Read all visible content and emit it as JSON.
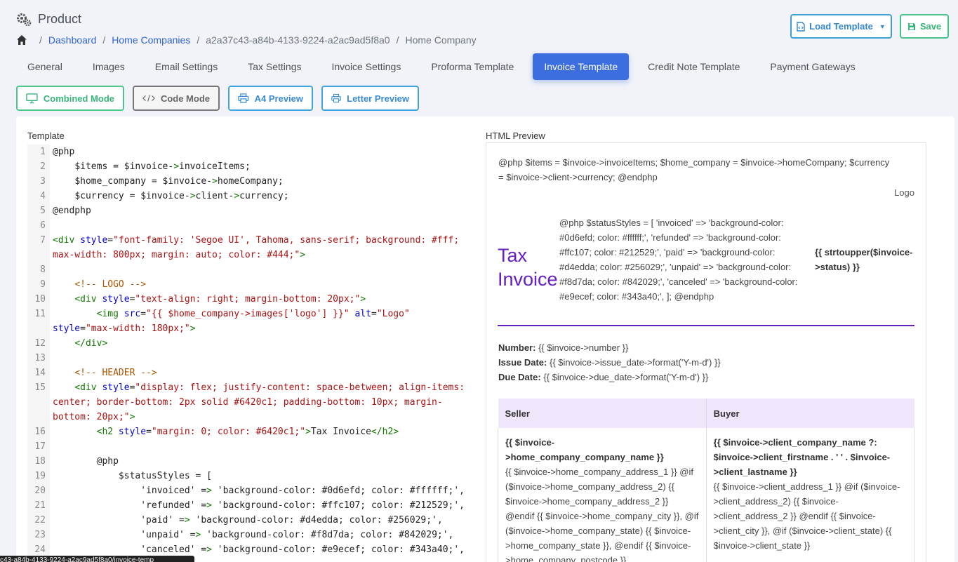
{
  "page": {
    "title": "Product"
  },
  "breadcrumb": {
    "items": [
      "Dashboard",
      "Home Companies",
      "a2a37c43-a84b-4133-9224-a2ac9ad5f8a0",
      "Home Company"
    ]
  },
  "actions": {
    "load_template": "Load Template",
    "save": "Save"
  },
  "tabs": [
    "General",
    "Images",
    "Email Settings",
    "Tax Settings",
    "Invoice Settings",
    "Proforma Template",
    "Invoice Template",
    "Credit Note Template",
    "Payment Gateways"
  ],
  "active_tab": "Invoice Template",
  "modes": {
    "combined": "Combined Mode",
    "code": "Code Mode",
    "a4": "A4 Preview",
    "letter": "Letter Preview"
  },
  "template_label": "Template",
  "preview_label": "HTML Preview",
  "code_lines": [
    "@php",
    "    $items = $invoice->invoiceItems;",
    "    $home_company = $invoice->homeCompany;",
    "    $currency = $invoice->client->currency;",
    "@endphp",
    "",
    "<div style=\"font-family: 'Segoe UI', Tahoma, sans-serif; background: #fff; max-width: 800px; margin: auto; color: #444;\">",
    "",
    "    <!-- LOGO -->",
    "    <div style=\"text-align: right; margin-bottom: 20px;\">",
    "        <img src=\"{{ $home_company->images['logo'] }}\" alt=\"Logo\" style=\"max-width: 180px;\">",
    "    </div>",
    "",
    "    <!-- HEADER -->",
    "    <div style=\"display: flex; justify-content: space-between; align-items: center; border-bottom: 2px solid #6420c1; padding-bottom: 10px; margin-bottom: 20px;\">",
    "        <h2 style=\"margin: 0; color: #6420c1;\">Tax Invoice</h2>",
    "",
    "        @php",
    "            $statusStyles = [",
    "                'invoiced' => 'background-color: #0d6efd; color: #ffffff;',",
    "                'refunded' => 'background-color: #ffc107; color: #212529;',",
    "                'paid' => 'background-color: #d4edda; color: #256029;',",
    "                'unpaid' => 'background-color: #f8d7da; color: #842029;',",
    "                'canceled' => 'background-color: #e9ecef; color: #343a40;',"
  ],
  "preview": {
    "php_block": "@php $items = $invoice->invoiceItems; $home_company = $invoice->homeCompany; $currency = $invoice->client->currency; @endphp",
    "logo_alt": "Logo",
    "title": "Tax Invoice",
    "status_php": "@php $statusStyles = [ 'invoiced' => 'background-color: #0d6efd; color: #ffffff;', 'refunded' => 'background-color: #ffc107; color: #212529;', 'paid' => 'background-color: #d4edda; color: #256029;', 'unpaid' => 'background-color: #f8d7da; color: #842029;', 'canceled' => 'background-color: #e9ecef; color: #343a40;', ]; @endphp",
    "status": "{{ strtoupper($invoice->status) }}",
    "number_label": "Number:",
    "number_value": "{{ $invoice->number }}",
    "issue_label": "Issue Date:",
    "issue_value": "{{ $invoice->issue_date->format('Y-m-d') }}",
    "due_label": "Due Date:",
    "due_value": "{{ $invoice->due_date->format('Y-m-d') }}",
    "seller_header": "Seller",
    "buyer_header": "Buyer",
    "seller_name": "{{ $invoice->home_company_company_name }}",
    "seller_body": "{{ $invoice->home_company_address_1 }} @if ($invoice->home_company_address_2) {{ $invoice->home_company_address_2 }} @endif {{ $invoice->home_company_city }}, @if ($invoice->home_company_state) {{ $invoice->home_company_state }}, @endif {{ $invoice->home_company_postcode }}",
    "buyer_name": "{{ $invoice->client_company_name ?: $invoice->client_firstname . ' ' . $invoice->client_lastname }}",
    "buyer_body": "{{ $invoice->client_address_1 }} @if ($invoice->client_address_2) {{ $invoice->client_address_2 }} @endif {{ $invoice->client_city }}, @if ($invoice->client_state) {{ $invoice->client_state }}"
  },
  "status_tooltip": "c43-a84b-4133-9224-a2ac9ad5f8a0/invoice-temp"
}
